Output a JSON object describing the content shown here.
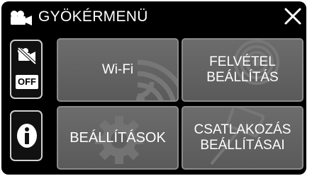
{
  "header": {
    "title": "GYÖKÉRMENÜ",
    "mode_icon": "video-camera-icon",
    "close_icon": "close-icon"
  },
  "sidebar": {
    "record_toggle": {
      "icon": "silent-mode-icon",
      "state_label": "OFF"
    },
    "info_button": {
      "icon": "info-icon"
    }
  },
  "tiles": [
    {
      "label": "Wi-Fi",
      "background_icon": "wifi-icon"
    },
    {
      "label": "FELVÉTEL\nBEÁLLÍTÁS",
      "background_icon": "record-settings-icon"
    },
    {
      "label": "BEÁLLÍTÁSOK",
      "background_icon": "gear-icon"
    },
    {
      "label": "CSATLAKOZÁS\nBEÁLLÍTÁSAI",
      "background_icon": "connection-icon"
    }
  ],
  "colors": {
    "screen_background": "#000000",
    "tile_background": "#636363",
    "tile_border": "#8a8a8a",
    "text": "#ffffff"
  }
}
